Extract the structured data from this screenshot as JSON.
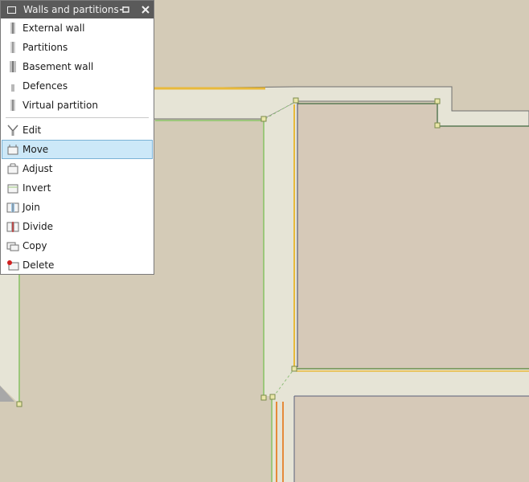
{
  "palette": {
    "title": "Walls and partitions",
    "pin_icon": "pin-icon",
    "close_icon": "close-icon",
    "types": [
      {
        "label": "External wall",
        "icon": "external-wall-icon"
      },
      {
        "label": "Partitions",
        "icon": "partition-icon"
      },
      {
        "label": "Basement wall",
        "icon": "basement-wall-icon"
      },
      {
        "label": "Defences",
        "icon": "defence-icon"
      },
      {
        "label": "Virtual partition",
        "icon": "virtual-partition-icon"
      }
    ],
    "tools": [
      {
        "label": "Edit",
        "icon": "edit-icon"
      },
      {
        "label": "Move",
        "icon": "move-icon",
        "selected": true
      },
      {
        "label": "Adjust",
        "icon": "adjust-icon"
      },
      {
        "label": "Invert",
        "icon": "invert-icon"
      },
      {
        "label": "Join",
        "icon": "join-icon"
      },
      {
        "label": "Divide",
        "icon": "divide-icon"
      },
      {
        "label": "Copy",
        "icon": "copy-icon"
      },
      {
        "label": "Delete",
        "icon": "delete-icon"
      }
    ]
  },
  "colors": {
    "floor": "#d4cbb7",
    "room": "#d6c9b8",
    "wall_fill": "#e6e4d6",
    "wall_outline": "#6f6f6f",
    "yellow_line": "#e8b93a",
    "green_line": "#9cc77b",
    "orange_line": "#e58a3a",
    "selection": "#cce8f8"
  }
}
